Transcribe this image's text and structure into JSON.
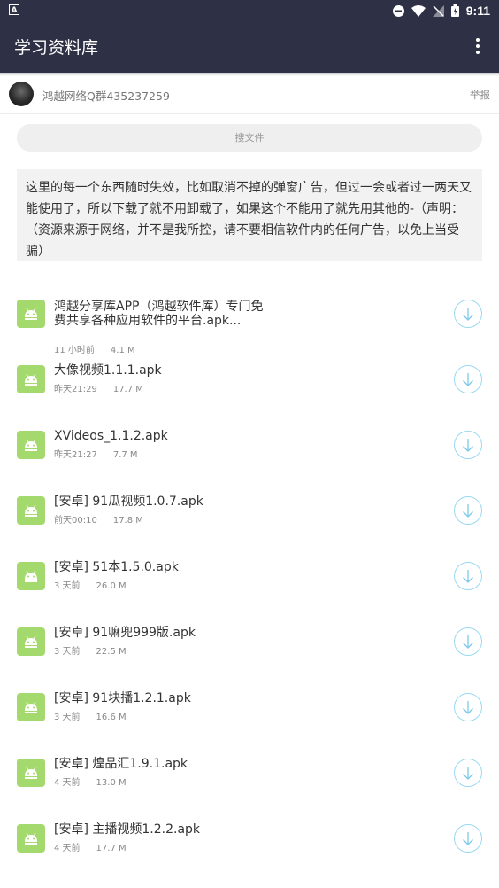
{
  "status_bar": {
    "badge": "A",
    "time": "9:11"
  },
  "app_bar": {
    "title": "学习资料库"
  },
  "owner": {
    "name": "鸿越网络Q群435237259",
    "report_label": "举报"
  },
  "search": {
    "placeholder": "搜文件"
  },
  "notice": {
    "text": "这里的每一个东西随时失效，比如取消不掉的弹窗广告，但过一会或者过一两天又能使用了，所以下载了就不用卸载了，如果这个不能用了就先用其他的-（声明：（资源来源于网络，并不是我所控，请不要相信软件内的任何广告，以免上当受骗）"
  },
  "files": [
    {
      "name": "鸿越分享库APP（鸿越软件库）专门免费共享各种应用软件的平台.apk...",
      "time": "11 小时前",
      "size": "4.1 M"
    },
    {
      "name": "大像视频1.1.1.apk",
      "time": "昨天21:29",
      "size": "17.7 M"
    },
    {
      "name": "XVideos_1.1.2.apk",
      "time": "昨天21:27",
      "size": "7.7 M"
    },
    {
      "name": "[安卓] 91瓜视频1.0.7.apk",
      "time": "前天00:10",
      "size": "17.8 M"
    },
    {
      "name": "[安卓] 51本1.5.0.apk",
      "time": "3 天前",
      "size": "26.0 M"
    },
    {
      "name": "[安卓] 91嘛兜999版.apk",
      "time": "3 天前",
      "size": "22.5 M"
    },
    {
      "name": "[安卓] 91块播1.2.1.apk",
      "time": "3 天前",
      "size": "16.6 M"
    },
    {
      "name": "[安卓] 煌品汇1.9.1.apk",
      "time": "4 天前",
      "size": "13.0 M"
    },
    {
      "name": "[安卓] 主播视频1.2.2.apk",
      "time": "4 天前",
      "size": "17.7 M"
    }
  ],
  "colors": {
    "bar": "#2e3045",
    "android_icon": "#a4d96d",
    "download_ring": "#9ad9f2"
  }
}
